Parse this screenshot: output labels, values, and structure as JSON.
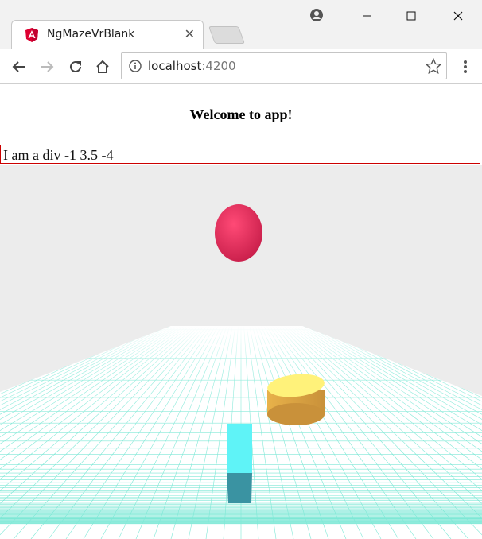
{
  "browser": {
    "tab_title": "NgMazeVrBlank",
    "url_host": "localhost",
    "url_port": ":4200"
  },
  "page": {
    "heading": "Welcome to app!",
    "div_text": "I am a div -1 3.5 -4"
  },
  "scene": {
    "sky_color": "#ececec",
    "floor_color": "#ffffff",
    "grid_color": "#7ee8d6",
    "sphere_color": "#ef2d5e",
    "cylinder_color": "#ffd85a",
    "box_color": "#4cc3d9"
  }
}
